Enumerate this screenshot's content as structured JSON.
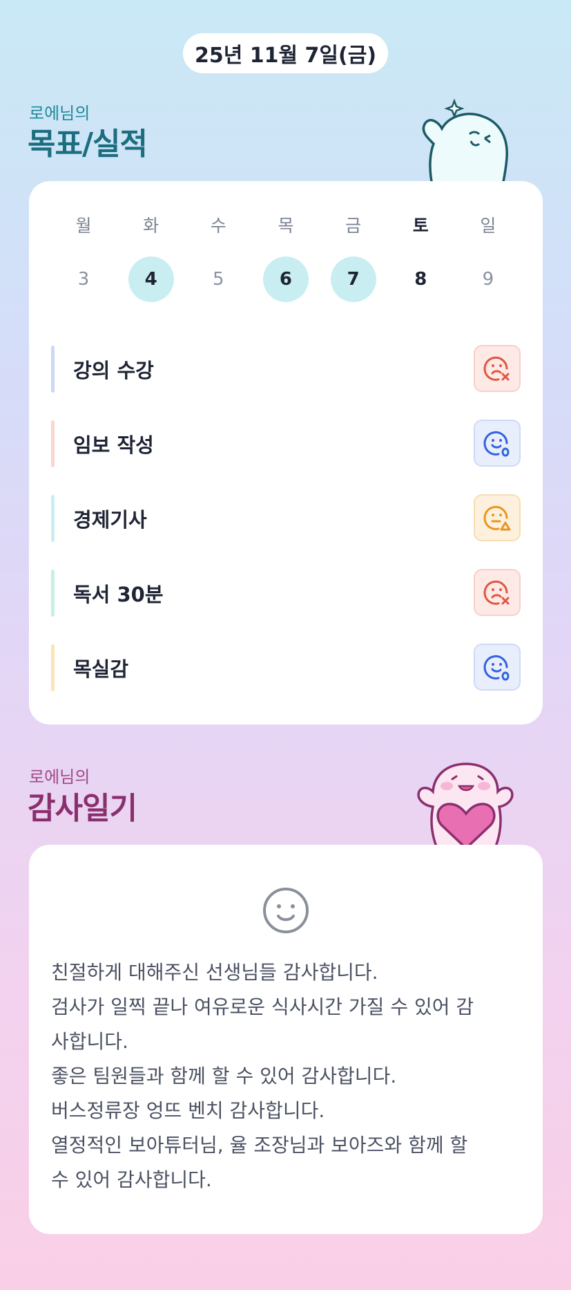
{
  "header": {
    "date": "25년 11월 7일(금)"
  },
  "goals_section": {
    "owner": "로에님의",
    "title": "목표/실적"
  },
  "week": {
    "days": [
      {
        "weekday": "월",
        "date": "3",
        "state": "none"
      },
      {
        "weekday": "화",
        "date": "4",
        "state": "done"
      },
      {
        "weekday": "수",
        "date": "5",
        "state": "none"
      },
      {
        "weekday": "목",
        "date": "6",
        "state": "done"
      },
      {
        "weekday": "금",
        "date": "7",
        "state": "done"
      },
      {
        "weekday": "토",
        "date": "8",
        "state": "today"
      },
      {
        "weekday": "일",
        "date": "9",
        "state": "none"
      }
    ]
  },
  "goals": [
    {
      "label": "강의 수강",
      "bar_color": "#cdd8f6",
      "status": "fail",
      "status_icon": "sad-x-face-icon"
    },
    {
      "label": "임보 작성",
      "bar_color": "#f9d6d0",
      "status": "ok",
      "status_icon": "smile-check-face-icon"
    },
    {
      "label": "경제기사",
      "bar_color": "#c9eef2",
      "status": "ok",
      "status_icon": "smile-check-face-icon"
    },
    {
      "label": "독서 30분",
      "bar_color": "#c7f0e0",
      "status": "fail",
      "status_icon": "sad-x-face-icon"
    },
    {
      "label": "목실감",
      "bar_color": "#fde3b6",
      "status": "ok",
      "status_icon": "smile-check-face-icon"
    }
  ],
  "goal_status_display": [
    "fail",
    "ok",
    "partial",
    "fail",
    "ok"
  ],
  "thanks_section": {
    "owner": "로에님의",
    "title": "감사일기",
    "mood_icon": "smiley-icon",
    "lines": [
      "친절하게 대해주신 선생님들 감사합니다.",
      "검사가 일찍 끝나 여유로운 식사시간 가질 수 있어 감",
      "사합니다.",
      "좋은 팀원들과 함께 할 수 있어 감사합니다.",
      "버스정류장 엉뜨 벤치 감사합니다.",
      "열정적인 보아튜터님, 율 조장님과 보아즈와 함께 할",
      "수 있어 감사합니다."
    ]
  },
  "colors": {
    "fail": "#e2553f",
    "ok": "#2f62e0",
    "partial": "#e8961e",
    "goal_title": "#1b6e7e",
    "thanks_title": "#8a2f6e"
  }
}
